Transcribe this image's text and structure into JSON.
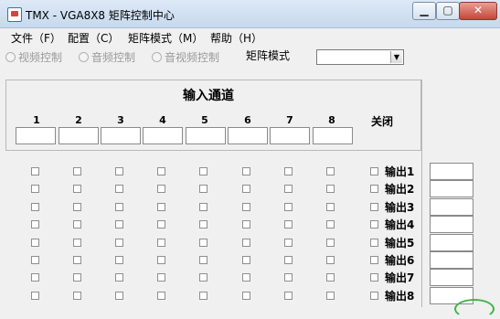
{
  "window": {
    "title": "TMX - VGA8X8 矩阵控制中心",
    "minimize_symbol": "▁",
    "maximize_symbol": "▢",
    "close_symbol": "✕"
  },
  "menu": {
    "items": [
      "文件（F）",
      "配置（C）",
      "矩阵模式（M）",
      "帮助（H）"
    ]
  },
  "controls": {
    "radios": [
      "视频控制",
      "音频控制",
      "音视频控制"
    ],
    "matrix_mode_label": "矩阵模式",
    "matrix_mode_value": "",
    "dropdown_arrow": "▼"
  },
  "input_channels": {
    "title": "输入通道",
    "numbers": [
      "1",
      "2",
      "3",
      "4",
      "5",
      "6",
      "7",
      "8"
    ],
    "close_label": "关闭"
  },
  "outputs": {
    "labels": [
      "输出1",
      "输出2",
      "输出3",
      "输出4",
      "输出5",
      "输出6",
      "输出7",
      "输出8"
    ]
  }
}
